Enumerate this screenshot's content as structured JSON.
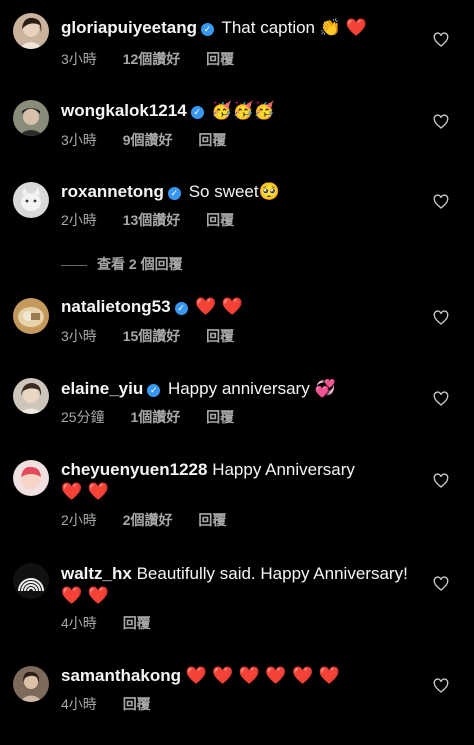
{
  "comments": [
    {
      "username": "gloriapuiyeetang",
      "verified": true,
      "text": "That caption",
      "emoji": "👏",
      "hearts": "❤️",
      "time": "3小時",
      "likes": "12個讚好",
      "reply": "回覆"
    },
    {
      "username": "wongkalok1214",
      "verified": true,
      "text": "",
      "emoji": "🥳🥳🥳",
      "hearts": "",
      "time": "3小時",
      "likes": "9個讚好",
      "reply": "回覆"
    },
    {
      "username": "roxannetong",
      "verified": true,
      "text": "So sweet",
      "emoji": "🥺",
      "hearts": "",
      "time": "2小時",
      "likes": "13個讚好",
      "reply": "回覆",
      "view_replies": "查看 2 個回覆"
    },
    {
      "username": "natalietong53",
      "verified": true,
      "text": "",
      "emoji": "",
      "hearts": "❤️ ❤️",
      "time": "3小時",
      "likes": "15個讚好",
      "reply": "回覆"
    },
    {
      "username": "elaine_yiu",
      "verified": true,
      "text": "Happy anniversary",
      "emoji": "💞",
      "hearts": "",
      "time": "25分鐘",
      "likes": "1個讚好",
      "reply": "回覆"
    },
    {
      "username": "cheyuenyuen1228",
      "verified": false,
      "text": "Happy Anniversary",
      "emoji": "",
      "hearts": "❤️ ❤️",
      "time": "2小時",
      "likes": "2個讚好",
      "reply": "回覆"
    },
    {
      "username": "waltz_hx",
      "verified": false,
      "text": "Beautifully said. Happy Anniversary!",
      "emoji": "",
      "hearts": "❤️ ❤️",
      "time": "4小時",
      "likes": "",
      "reply": "回覆"
    },
    {
      "username": "samanthakong",
      "verified": false,
      "text": "",
      "emoji": "",
      "hearts": "❤️ ❤️ ❤️ ❤️ ❤️ ❤️",
      "time": "4小時",
      "likes": "",
      "reply": "回覆"
    }
  ],
  "icons": {
    "verified": "verified-badge-icon",
    "like": "heart-outline-icon"
  },
  "colors": {
    "background": "#000000",
    "text": "#f5f5f5",
    "secondary": "#a8a8a8",
    "verified": "#3897f0",
    "heart": "#ed1c3a"
  }
}
